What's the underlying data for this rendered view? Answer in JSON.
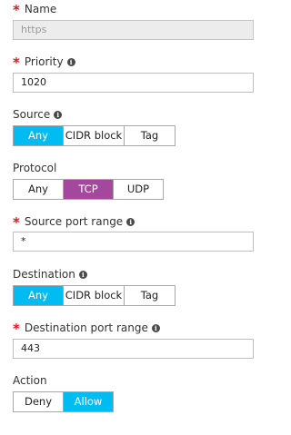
{
  "name": {
    "label": "Name",
    "value": "https"
  },
  "priority": {
    "label": "Priority",
    "value": "1020"
  },
  "source": {
    "label": "Source",
    "options": [
      "Any",
      "CIDR block",
      "Tag"
    ],
    "selected": "Any"
  },
  "protocol": {
    "label": "Protocol",
    "options": [
      "Any",
      "TCP",
      "UDP"
    ],
    "selected": "TCP"
  },
  "source_port_range": {
    "label": "Source port range",
    "value": "*"
  },
  "destination": {
    "label": "Destination",
    "options": [
      "Any",
      "CIDR block",
      "Tag"
    ],
    "selected": "Any"
  },
  "destination_port_range": {
    "label": "Destination port range",
    "value": "443"
  },
  "action": {
    "label": "Action",
    "options": [
      "Deny",
      "Allow"
    ],
    "selected": "Allow"
  },
  "colors": {
    "required": "#e81123",
    "selected_blue": "#00bcf2",
    "selected_purple": "#a4489e"
  },
  "icons": {
    "info": "info-icon",
    "required": "required-asterisk"
  }
}
